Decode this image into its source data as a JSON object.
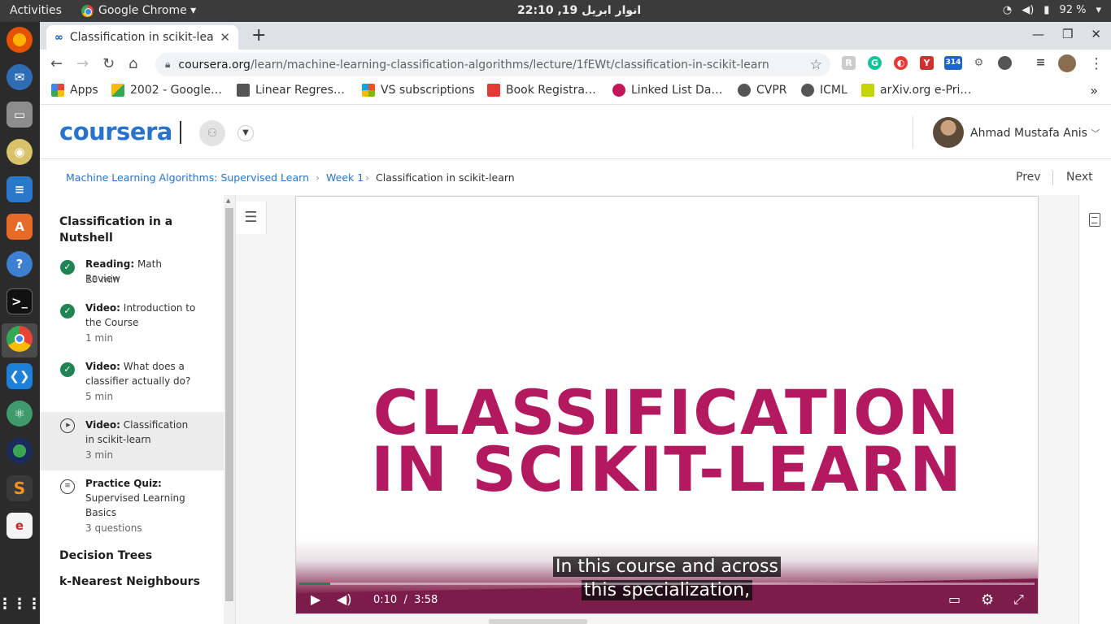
{
  "topbar": {
    "activities": "Activities",
    "app_name": "Google Chrome ▾",
    "clock": "انوار ابریل 19, 22:10",
    "battery": "92 %"
  },
  "dock": {
    "items": [
      "firefox",
      "thunderbird",
      "files",
      "rhythmbox",
      "writer",
      "software-center",
      "help",
      "terminal",
      "chrome",
      "vscode",
      "atom",
      "app",
      "sublime",
      "evince",
      "show-apps"
    ]
  },
  "browser": {
    "tab_title": "Classification in scikit-lea",
    "tab_favicon": "∞",
    "url_host": "coursera.org",
    "url_path": "/learn/machine-learning-classification-algorithms/lecture/1fEWt/classification-in-scikit-learn",
    "ext_badge": "314"
  },
  "bookmarks": [
    {
      "label": "Apps",
      "color": "#ea4335"
    },
    {
      "label": "2002 - Google…",
      "color": "#fbbc05"
    },
    {
      "label": "Linear Regres…",
      "color": "#555555"
    },
    {
      "label": "VS subscriptions",
      "color": "#00a4ef"
    },
    {
      "label": "Book Registra…",
      "color": "#e53935"
    },
    {
      "label": "Linked List Da…",
      "color": "#c2185b"
    },
    {
      "label": "CVPR",
      "color": "#555555"
    },
    {
      "label": "ICML",
      "color": "#555555"
    },
    {
      "label": "arXiv.org e-Pri…",
      "color": "#c6d400"
    }
  ],
  "header": {
    "logo": "coursera",
    "user_name": "Ahmad Mustafa Anis"
  },
  "breadcrumb": {
    "course": "Machine Learning Algorithms: Supervised Learning Tip",
    "week": "Week 1",
    "current": "Classification in scikit-learn",
    "sep": "›",
    "prev": "Prev",
    "next": "Next"
  },
  "sidebar": {
    "section_title": "Classification in a Nutshell",
    "items": [
      {
        "kind": "Reading:",
        "title": "Math Review",
        "duration": "10 min",
        "status": "done"
      },
      {
        "kind": "Video:",
        "title": "Introduction to the Course",
        "duration": "1 min",
        "status": "done"
      },
      {
        "kind": "Video:",
        "title": "What does a classifier actually do?",
        "duration": "5 min",
        "status": "done"
      },
      {
        "kind": "Video:",
        "title": "Classification in scikit-learn",
        "duration": "3 min",
        "status": "current"
      },
      {
        "kind": "Practice Quiz:",
        "title": "Supervised Learning Basics",
        "duration": "3 questions",
        "status": "quiz"
      }
    ],
    "sections": [
      "Decision Trees",
      "k-Nearest Neighbours"
    ]
  },
  "video": {
    "title_line1": "CLASSIFICATION",
    "title_line2": "IN SCIKIT-LEARN",
    "caption_line1": "In this course and across",
    "caption_line2": "this specialization,",
    "current_time": "0:10",
    "time_sep": "/",
    "duration": "3:58",
    "progress_fraction": 0.042,
    "accent": "#b2195f"
  }
}
